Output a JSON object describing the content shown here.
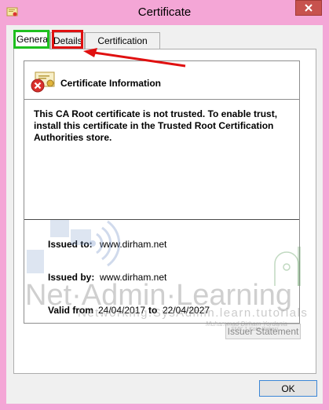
{
  "window": {
    "title": "Certificate",
    "accent_close": "#c7524e",
    "frame_color": "#f4a6d6"
  },
  "tabs": [
    {
      "label": "General",
      "selected": true
    },
    {
      "label": "Details",
      "selected": false
    },
    {
      "label": "Certification Path",
      "selected": false
    }
  ],
  "annotations": {
    "green_box": "#20c020",
    "red_box": "#e01010"
  },
  "general": {
    "heading": "Certificate Information",
    "icon": "certificate-error-icon",
    "warning": "This CA Root certificate is not trusted. To enable trust, install this certificate in the Trusted Root Certification Authorities store.",
    "issued_to_label": "Issued to:",
    "issued_to_value": "www.dirham.net",
    "issued_by_label": "Issued by:",
    "issued_by_value": "www.dirham.net",
    "valid_from_label": "Valid from",
    "valid_from_value": "24/04/2017",
    "valid_to_label": "to",
    "valid_to_value": "22/04/2027",
    "issuer_statement_label": "Issuer Statement"
  },
  "footer": {
    "ok_label": "OK"
  },
  "watermark": {
    "main": "Net·Admin·Learning",
    "sub": "Networking.SysAdmin.learn.tutorials",
    "author": "Muhammad Dirham Yordania",
    "author_sub": "SMK 1 Kota Bekasi"
  }
}
